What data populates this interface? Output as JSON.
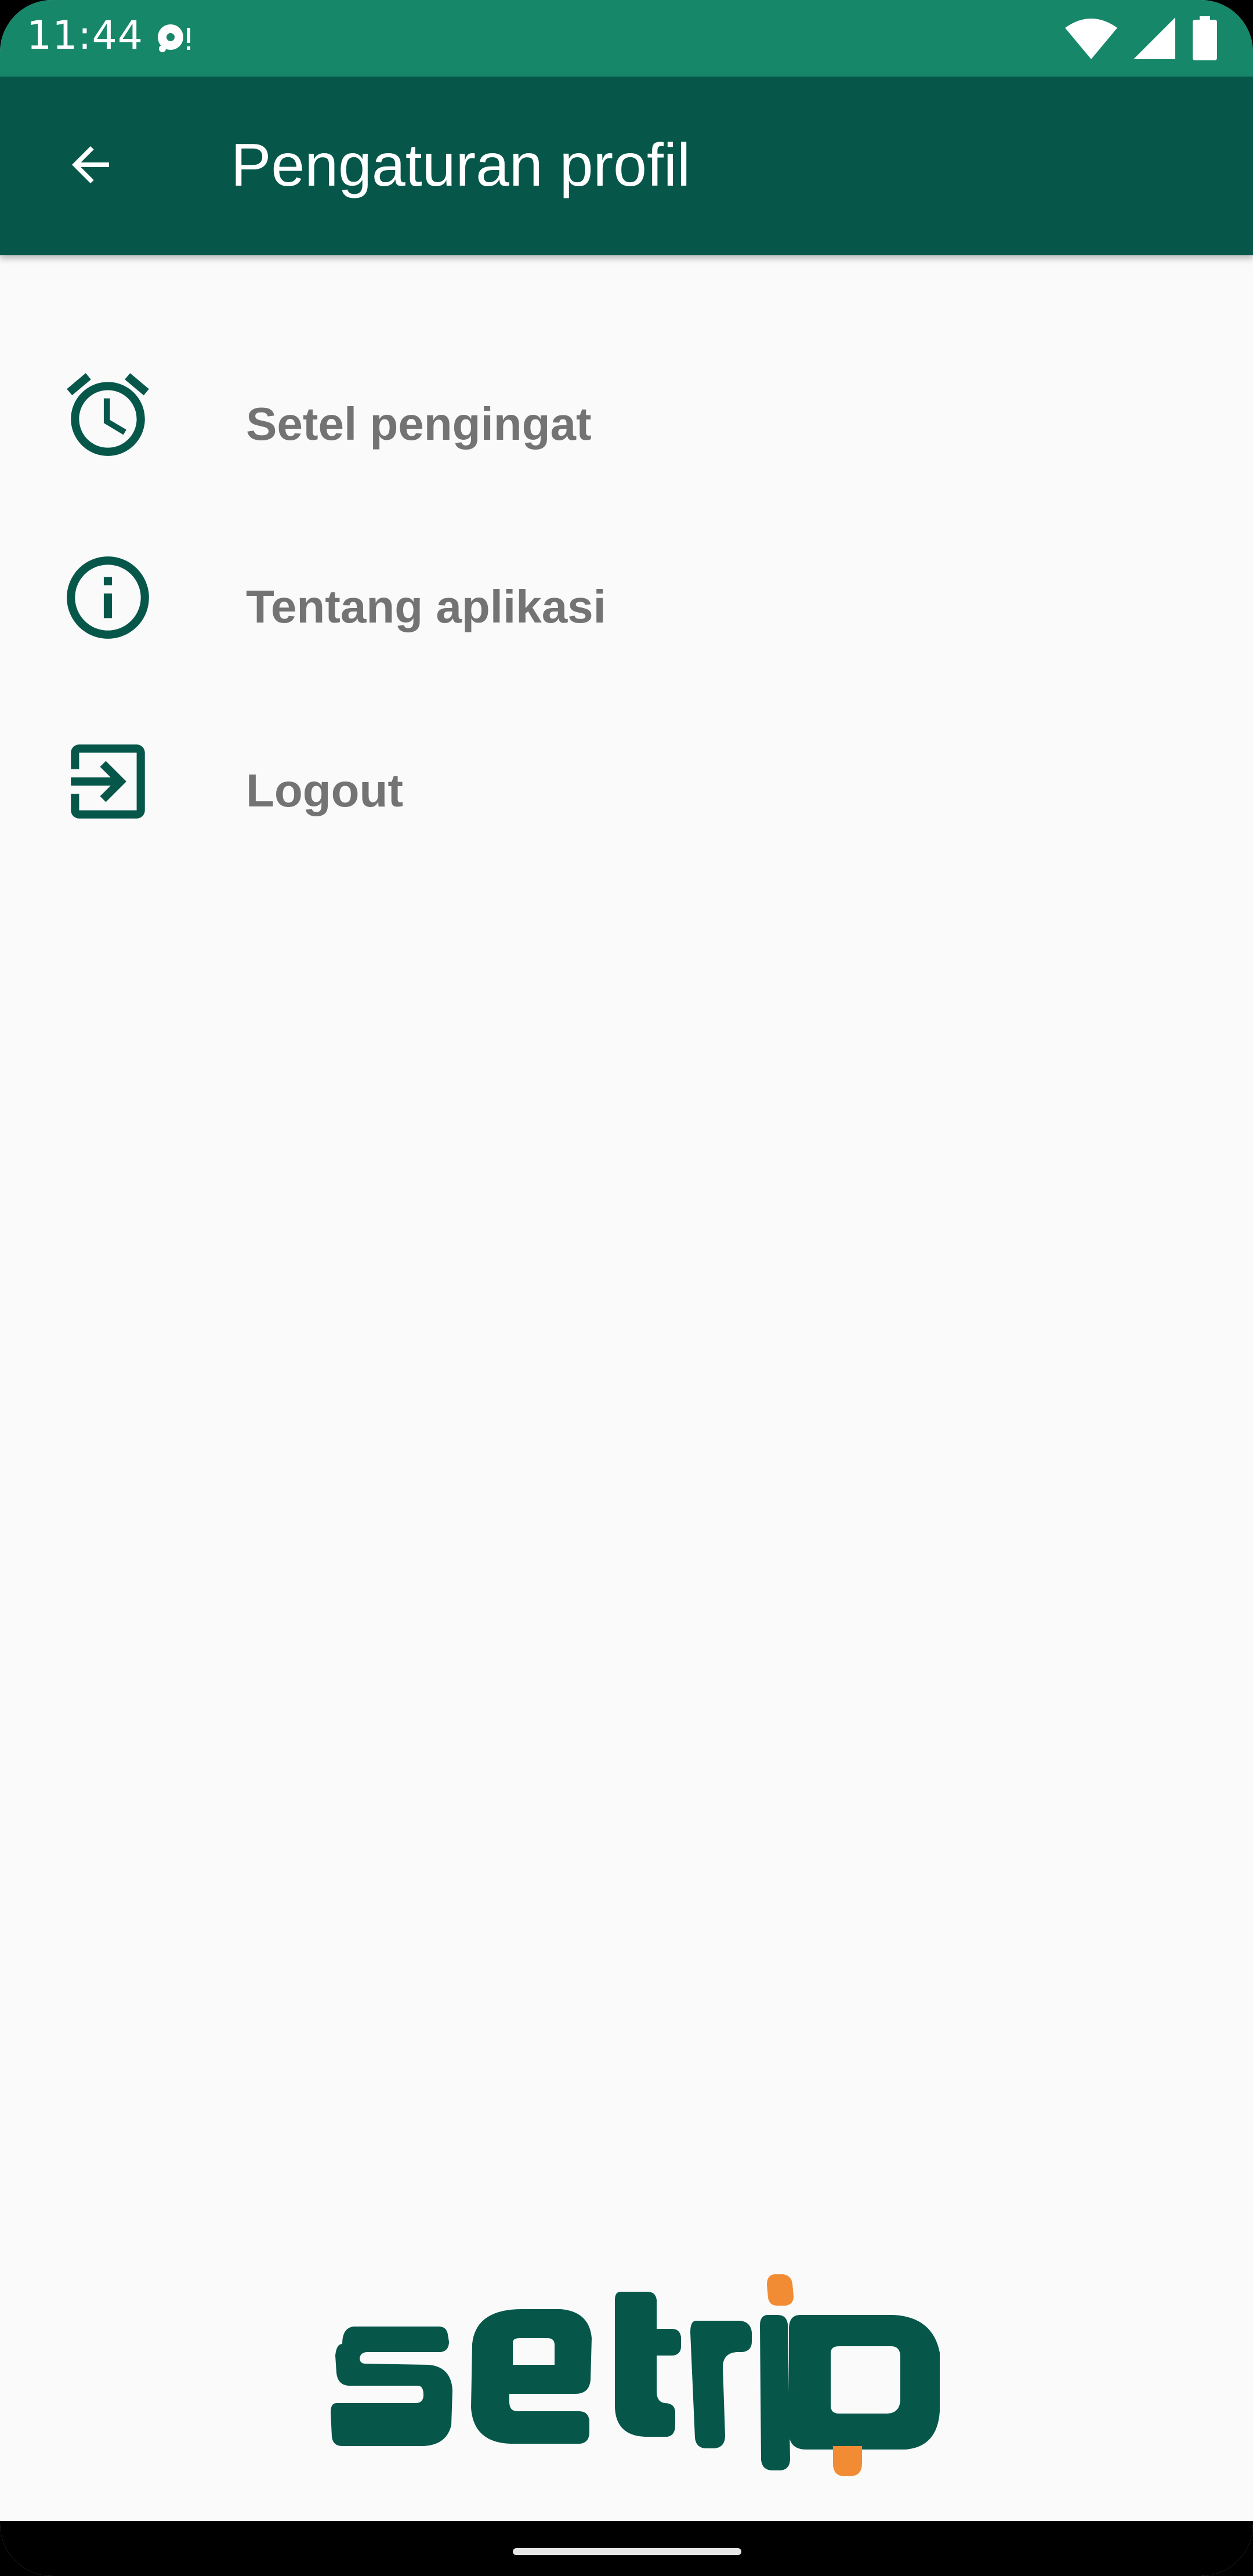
{
  "status_bar": {
    "time": "11:44",
    "background": "#17876a",
    "icons": [
      "media-playing-icon",
      "wifi-icon",
      "signal-icon",
      "battery-icon"
    ]
  },
  "app_bar": {
    "title": "Pengaturan profil",
    "background": "#06574a",
    "back_icon": "arrow-back-icon"
  },
  "menu": {
    "items": [
      {
        "label": "Setel pengingat",
        "icon": "alarm-clock-icon"
      },
      {
        "label": "Tentang aplikasi",
        "icon": "info-icon"
      },
      {
        "label": "Logout",
        "icon": "logout-icon"
      }
    ],
    "icon_color": "#06574a",
    "label_color": "#737373"
  },
  "logo": {
    "text": "setrip",
    "primary_color": "#06574a",
    "accent_color": "#f28c34"
  }
}
